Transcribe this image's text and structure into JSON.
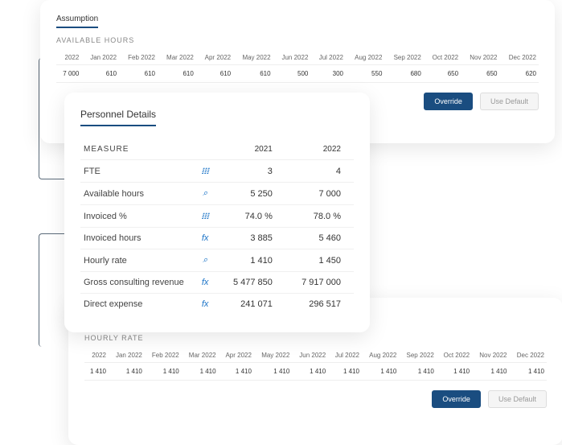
{
  "tabs": {
    "assumption": "Assumption",
    "personnel": "Personnel Details"
  },
  "sections": {
    "available_hours": "AVAILABLE HOURS",
    "hourly_rate": "HOURLY RATE",
    "measure": "MEASURE"
  },
  "buttons": {
    "override": "Override",
    "use_default": "Use Default"
  },
  "months": [
    "2022",
    "Jan 2022",
    "Feb 2022",
    "Mar 2022",
    "Apr 2022",
    "May 2022",
    "Jun 2022",
    "Jul 2022",
    "Aug 2022",
    "Sep 2022",
    "Oct 2022",
    "Nov 2022",
    "Dec 2022"
  ],
  "available_hours": [
    "7 000",
    "610",
    "610",
    "610",
    "610",
    "610",
    "500",
    "300",
    "550",
    "680",
    "650",
    "650",
    "620"
  ],
  "hourly_rate": [
    "1 410",
    "1 410",
    "1 410",
    "1 410",
    "1 410",
    "1 410",
    "1 410",
    "1 410",
    "1 410",
    "1 410",
    "1 410",
    "1 410",
    "1 410"
  ],
  "years": {
    "y1": "2021",
    "y2": "2022"
  },
  "measures": [
    {
      "name": "FTE",
      "icon": "bar",
      "v1": "3",
      "v2": "4"
    },
    {
      "name": "Available hours",
      "icon": "search",
      "v1": "5 250",
      "v2": "7 000"
    },
    {
      "name": "Invoiced %",
      "icon": "bar",
      "v1": "74.0 %",
      "v2": "78.0 %"
    },
    {
      "name": "Invoiced hours",
      "icon": "fx",
      "v1": "3 885",
      "v2": "5 460"
    },
    {
      "name": "Hourly rate",
      "icon": "search",
      "v1": "1 410",
      "v2": "1 450"
    },
    {
      "name": "Gross consulting revenue",
      "icon": "fx",
      "v1": "5 477 850",
      "v2": "7 917 000"
    },
    {
      "name": "Direct expense",
      "icon": "fx",
      "v1": "241 071",
      "v2": "296 517"
    }
  ]
}
